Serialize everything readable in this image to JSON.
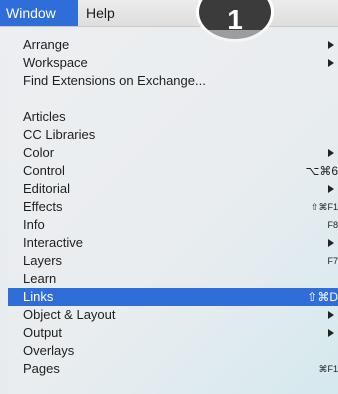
{
  "menubar": {
    "window": "Window",
    "help": "Help"
  },
  "step_badge": "1",
  "menu": {
    "group1": [
      {
        "label": "Arrange",
        "submenu": true
      },
      {
        "label": "Workspace",
        "submenu": true
      },
      {
        "label": "Find Extensions on Exchange...",
        "submenu": false
      }
    ],
    "group2": [
      {
        "label": "Articles"
      },
      {
        "label": "CC Libraries"
      },
      {
        "label": "Color",
        "submenu": true
      },
      {
        "label": "Control",
        "shortcut": "⌥⌘6"
      },
      {
        "label": "Editorial",
        "submenu": true
      },
      {
        "label": "Effects",
        "shortcut": "⇧⌘F1"
      },
      {
        "label": "Info",
        "shortcut": "F8"
      },
      {
        "label": "Interactive",
        "submenu": true
      },
      {
        "label": "Layers",
        "shortcut": "F7"
      },
      {
        "label": "Learn"
      },
      {
        "label": "Links",
        "shortcut": "⇧⌘D",
        "highlighted": true
      },
      {
        "label": "Object & Layout",
        "submenu": true
      },
      {
        "label": "Output",
        "submenu": true
      },
      {
        "label": "Overlays"
      },
      {
        "label": "Pages",
        "shortcut": "⌘F1"
      }
    ]
  },
  "colors": {
    "highlight": "#2f6ed8",
    "badge": "#3b3b3b"
  }
}
